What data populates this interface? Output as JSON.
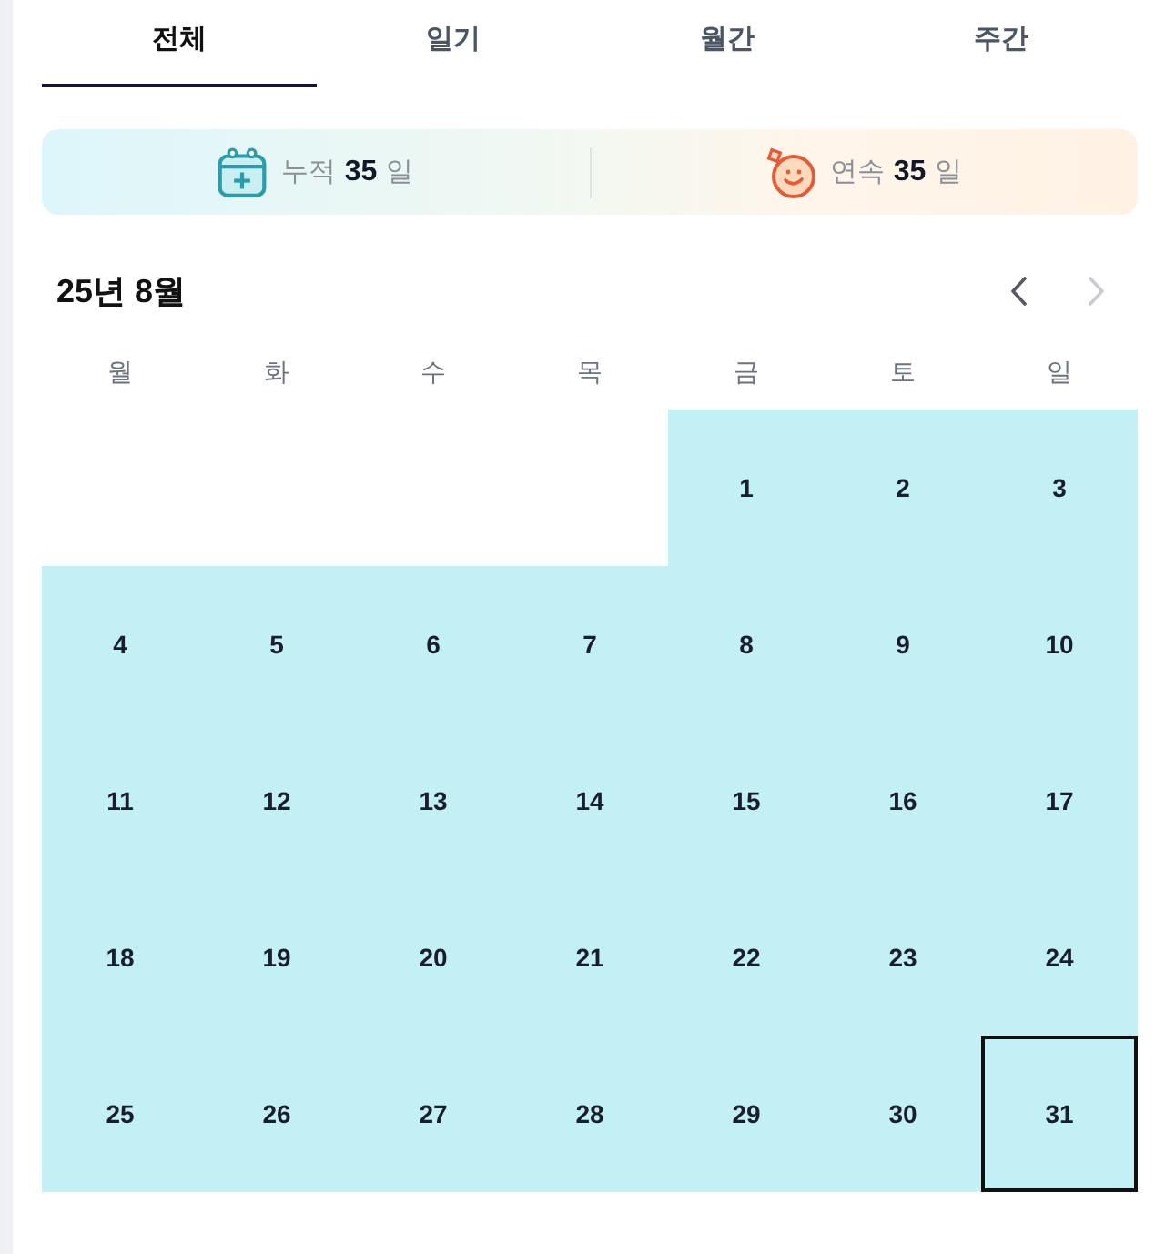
{
  "tabs": [
    {
      "label": "전체",
      "selected": true
    },
    {
      "label": "일기",
      "selected": false
    },
    {
      "label": "월간",
      "selected": false
    },
    {
      "label": "주간",
      "selected": false
    }
  ],
  "stats": [
    {
      "kind": "total",
      "label": "누적",
      "value": "35",
      "unit": "일"
    },
    {
      "kind": "streak",
      "label": "연속",
      "value": "35",
      "unit": "일"
    }
  ],
  "calendar": {
    "month_label": "25년 8월",
    "prev_button": {
      "disabled": false
    },
    "next_button": {
      "disabled": true
    },
    "weekdays": [
      "월",
      "화",
      "수",
      "목",
      "금",
      "토",
      "일"
    ],
    "weeks": [
      {
        "days": [
          {
            "day": "1",
            "recorded": true,
            "selected": false
          },
          {
            "day": "2",
            "recorded": true,
            "selected": false
          },
          {
            "day": "3",
            "recorded": true,
            "selected": false
          }
        ]
      },
      {
        "days": [
          {
            "day": "4",
            "recorded": true,
            "selected": false
          },
          {
            "day": "5",
            "recorded": true,
            "selected": false
          },
          {
            "day": "6",
            "recorded": true,
            "selected": false
          },
          {
            "day": "7",
            "recorded": true,
            "selected": false
          },
          {
            "day": "8",
            "recorded": true,
            "selected": false
          },
          {
            "day": "9",
            "recorded": true,
            "selected": false
          },
          {
            "day": "10",
            "recorded": true,
            "selected": false
          }
        ]
      },
      {
        "days": [
          {
            "day": "11",
            "recorded": true,
            "selected": false
          },
          {
            "day": "12",
            "recorded": true,
            "selected": false
          },
          {
            "day": "13",
            "recorded": true,
            "selected": false
          },
          {
            "day": "14",
            "recorded": true,
            "selected": false
          },
          {
            "day": "15",
            "recorded": true,
            "selected": false
          },
          {
            "day": "16",
            "recorded": true,
            "selected": false
          },
          {
            "day": "17",
            "recorded": true,
            "selected": false
          }
        ]
      },
      {
        "days": [
          {
            "day": "18",
            "recorded": true,
            "selected": false
          },
          {
            "day": "19",
            "recorded": true,
            "selected": false
          },
          {
            "day": "20",
            "recorded": true,
            "selected": false
          },
          {
            "day": "21",
            "recorded": true,
            "selected": false
          },
          {
            "day": "22",
            "recorded": true,
            "selected": false
          },
          {
            "day": "23",
            "recorded": true,
            "selected": false
          },
          {
            "day": "24",
            "recorded": true,
            "selected": false
          }
        ]
      },
      {
        "days": [
          {
            "day": "25",
            "recorded": true,
            "selected": false
          },
          {
            "day": "26",
            "recorded": true,
            "selected": false
          },
          {
            "day": "27",
            "recorded": true,
            "selected": false
          },
          {
            "day": "28",
            "recorded": true,
            "selected": false
          },
          {
            "day": "29",
            "recorded": true,
            "selected": false
          },
          {
            "day": "30",
            "recorded": true,
            "selected": false
          },
          {
            "day": "31",
            "recorded": true,
            "selected": true
          }
        ]
      }
    ]
  }
}
